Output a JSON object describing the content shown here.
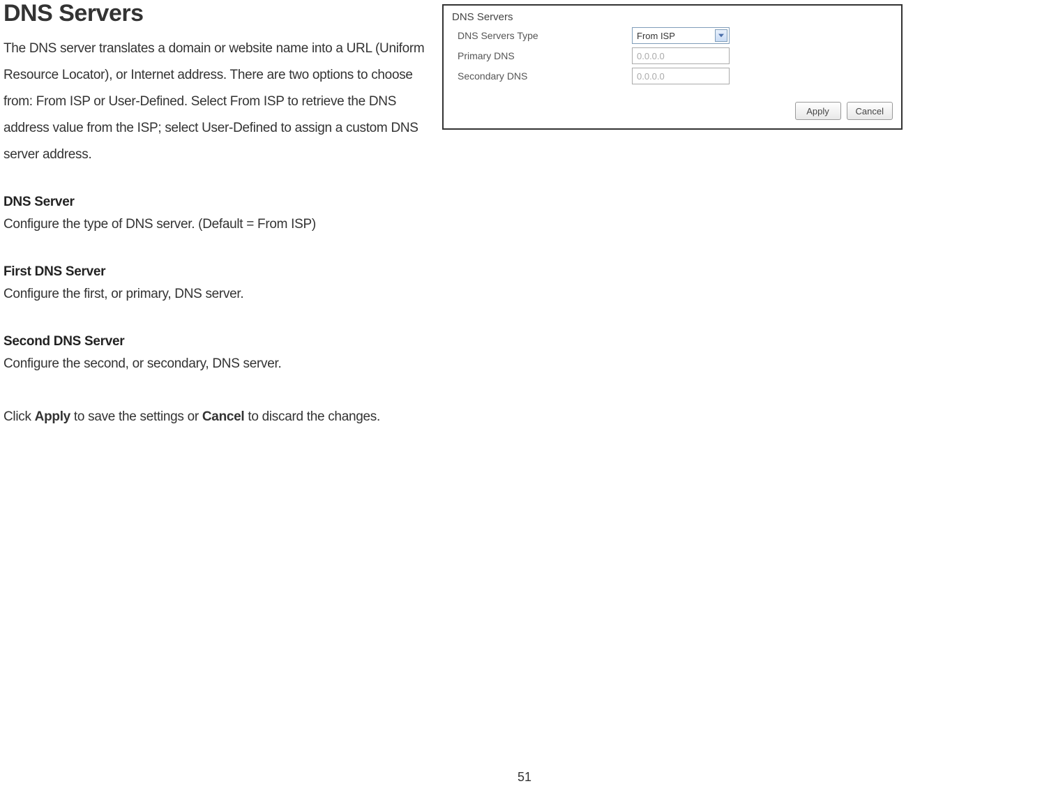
{
  "heading": "DNS Servers",
  "intro": "The DNS server translates a domain or website name into a URL (Uniform Resource Locator), or Internet address. There are two options to choose from: From ISP or User-Defined. Select From ISP to retrieve the DNS address value from the ISP; select User-Defined to assign a custom DNS server address.",
  "sections": [
    {
      "title": "DNS Server",
      "desc": "Configure the type of DNS server. (Default = From ISP)"
    },
    {
      "title": "First DNS Server",
      "desc": "Configure the first, or primary, DNS server."
    },
    {
      "title": "Second DNS Server",
      "desc": "Configure the second, or secondary, DNS server."
    }
  ],
  "final_pre": "Click ",
  "final_apply": "Apply",
  "final_mid": " to save the settings or ",
  "final_cancel": "Cancel",
  "final_post": " to discard the changes.",
  "panel": {
    "title": "DNS Servers",
    "rows": [
      {
        "label": "DNS Servers Type",
        "type": "select",
        "value": "From ISP"
      },
      {
        "label": "Primary DNS",
        "type": "input",
        "placeholder": "0.0.0.0"
      },
      {
        "label": "Secondary DNS",
        "type": "input",
        "placeholder": "0.0.0.0"
      }
    ],
    "apply": "Apply",
    "cancel": "Cancel"
  },
  "page_number": "51"
}
